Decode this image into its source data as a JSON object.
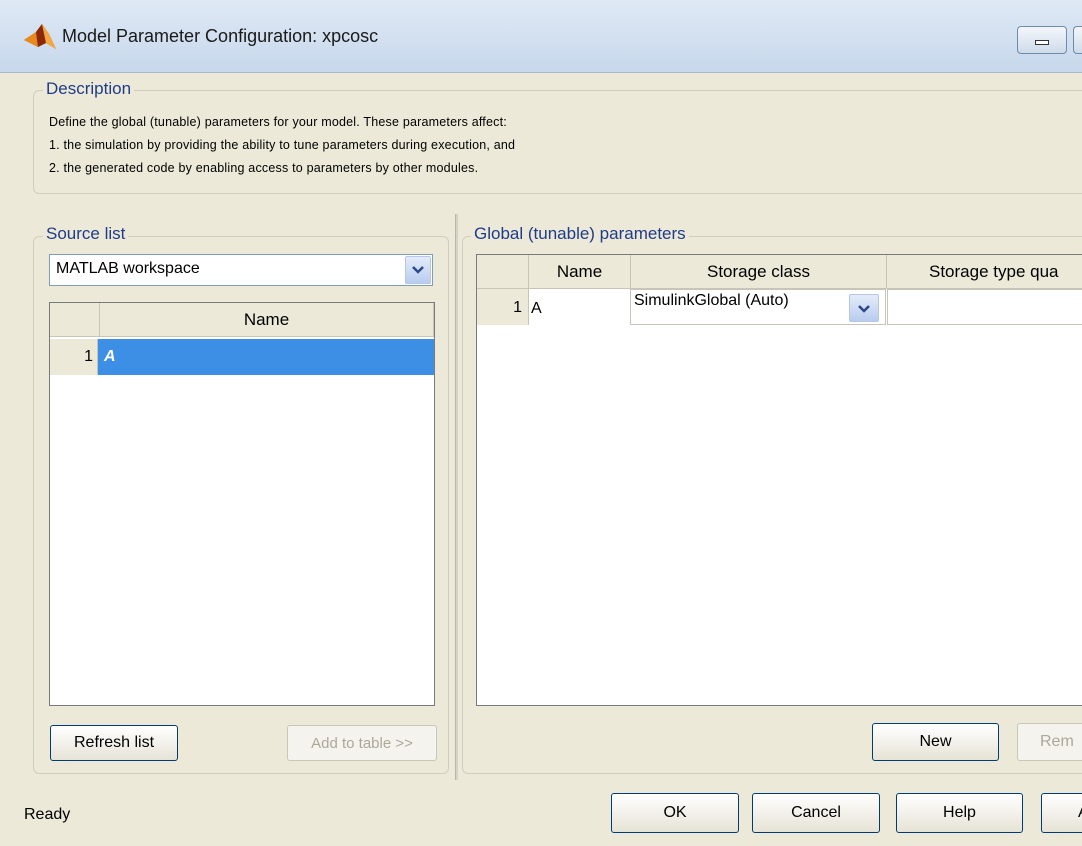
{
  "window": {
    "title": "Model Parameter Configuration: xpcosc",
    "icon": "matlab-logo-icon"
  },
  "description": {
    "legend": "Description",
    "lines": [
      "Define the global (tunable) parameters for your model. These parameters affect:",
      "1. the simulation by providing the ability to tune parameters during execution, and",
      "2. the generated code by enabling access to parameters by other modules."
    ]
  },
  "source_list": {
    "legend": "Source list",
    "combo_value": "MATLAB workspace",
    "table": {
      "column_header": "Name",
      "rows": [
        {
          "num": "1",
          "name": "A",
          "selected": true
        }
      ]
    },
    "refresh_label": "Refresh list",
    "add_label": "Add to table >>"
  },
  "global_params": {
    "legend": "Global (tunable) parameters",
    "columns": [
      "Name",
      "Storage class",
      "Storage type qua"
    ],
    "rows": [
      {
        "num": "1",
        "name": "A",
        "storage_class": "SimulinkGlobal (Auto)",
        "qualifier": ""
      }
    ],
    "new_label": "New",
    "remove_label": "Rem"
  },
  "footer": {
    "status": "Ready",
    "ok_label": "OK",
    "cancel_label": "Cancel",
    "help_label": "Help",
    "apply_label": "A"
  },
  "colors": {
    "selection": "#3d8ee5",
    "legend_text": "#1f3c88",
    "dialog_bg": "#ece9d8"
  }
}
